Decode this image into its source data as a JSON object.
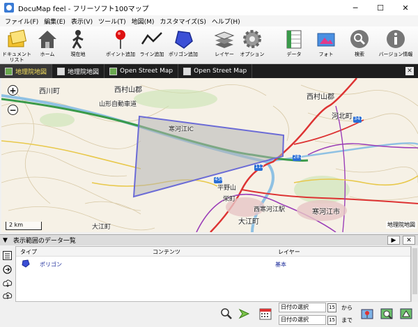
{
  "window": {
    "title": "DocuMap feel - フリーソフト100マップ",
    "minimize": "─",
    "maximize": "☐",
    "close": "✕"
  },
  "menu": [
    "ファイル(F)",
    "編集(E)",
    "表示(V)",
    "ツール(T)",
    "地図(M)",
    "カスタマイズ(S)",
    "ヘルプ(H)"
  ],
  "toolbar": {
    "doc_list": "ドキュメント\nリスト",
    "home": "ホーム",
    "current": "現在地",
    "add_point": "ポイント追加",
    "add_line": "ライン追加",
    "add_polygon": "ポリゴン追加",
    "layer": "レイヤー",
    "option": "オプション",
    "data": "データ",
    "photo": "フォト",
    "search": "検索",
    "version": "バージョン情報"
  },
  "tabs": [
    "地理院地図",
    "地理院地図",
    "Open Street Map",
    "Open Street Map"
  ],
  "tab_close": "✕",
  "map": {
    "zoom_in": "+",
    "zoom_out": "−",
    "labels": {
      "nishikawa": "西川町",
      "nishimurayama1": "西村山郡",
      "nishimurayama2": "西村山郡",
      "kahoku": "河北町",
      "sagae": "寒河江市",
      "oe": "大江町",
      "yamagata_exp": "山形自動車道",
      "hiraguchi": "平野山",
      "sagae_station": "西寒河江駅",
      "sakaecho": "栄町",
      "nanbu": "寒河江IC",
      "route_112": "112",
      "route_458": "458",
      "route_287": "287",
      "route_347": "347",
      "ota": "大江町"
    },
    "scale": "2 km",
    "credit": "地理院地図"
  },
  "panel": {
    "title": "表示範囲のデータ一覧",
    "collapse": "▼",
    "play": "▶",
    "close": "✕"
  },
  "table": {
    "columns": [
      "タイプ",
      "コンテンツ",
      "レイヤー"
    ],
    "rows": [
      {
        "type": "ポリゴン",
        "content": "",
        "layer": "基本"
      }
    ]
  },
  "bottom": {
    "date_from": "日付の選択",
    "date_to": "日付の選択",
    "cal_icon": "15",
    "from_label": "から",
    "to_label": "まで"
  }
}
